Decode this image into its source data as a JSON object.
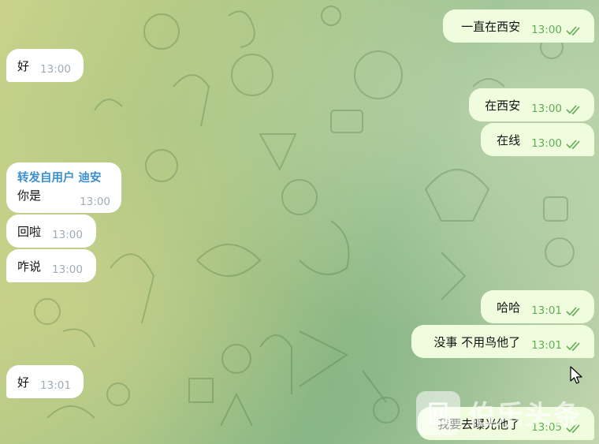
{
  "messages": [
    {
      "id": "m1",
      "dir": "out",
      "text": "一直在西安",
      "time": "13:00",
      "read": true
    },
    {
      "id": "m2",
      "dir": "in",
      "text": "好",
      "time": "13:00"
    },
    {
      "id": "m3",
      "dir": "out",
      "text": "在西安",
      "time": "13:00",
      "read": true
    },
    {
      "id": "m4",
      "dir": "out",
      "text": "在线",
      "time": "13:00",
      "read": true
    },
    {
      "id": "m5",
      "dir": "in",
      "forwarded_header": "转发自用户 迪安",
      "text": "你是",
      "time": "13:00"
    },
    {
      "id": "m6",
      "dir": "in",
      "text": "回啦",
      "time": "13:00"
    },
    {
      "id": "m7",
      "dir": "in",
      "text": "咋说",
      "time": "13:00"
    },
    {
      "id": "m8",
      "dir": "out",
      "text": "哈哈",
      "time": "13:01",
      "read": true
    },
    {
      "id": "m9",
      "dir": "out",
      "text": "没事  不用鸟他了",
      "time": "13:01",
      "read": true
    },
    {
      "id": "m10",
      "dir": "in",
      "text": "好",
      "time": "13:01"
    },
    {
      "id": "m11",
      "dir": "out",
      "text": "我要去曝光他了",
      "time": "13:05",
      "read": true
    }
  ],
  "watermark": {
    "text": "伯乐头条"
  },
  "colors": {
    "incoming_bubble": "#ffffff",
    "outgoing_bubble": "#effdde",
    "outgoing_time": "#62ac55",
    "incoming_time": "#a0acb6",
    "forward_name": "#3a8fd0"
  },
  "icons": {
    "read_receipt": "double-check-icon",
    "cursor": "mouse-pointer-icon"
  }
}
